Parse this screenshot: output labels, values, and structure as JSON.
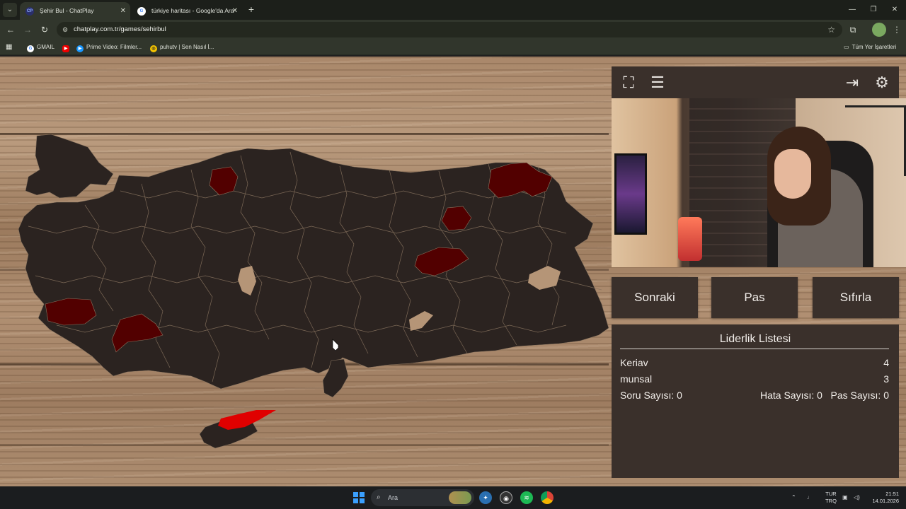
{
  "browser": {
    "tabs": [
      {
        "title": "Şehir Bul - ChatPlay",
        "favicon": "CP",
        "active": true
      },
      {
        "title": "türkiye haritası - Google'da Ara",
        "favicon": "G",
        "active": false
      }
    ],
    "url": "chatplay.com.tr/games/sehirbul",
    "bookmarks": [
      {
        "label": "GMAIL",
        "icon": "google-icon"
      },
      {
        "label": "",
        "icon": "youtube-icon"
      },
      {
        "label": "Prime Video: Filmler...",
        "icon": "prime-video-icon"
      },
      {
        "label": "puhutv | Sen Nasıl İ...",
        "icon": "puhutv-icon"
      }
    ],
    "all_bookmarks_label": "Tüm Yer İşaretleri"
  },
  "game": {
    "buttons": {
      "next": "Sonraki",
      "pass": "Pas",
      "reset": "Sıfırla"
    },
    "leaderboard": {
      "title": "Liderlik Listesi",
      "entries": [
        {
          "name": "Keriav",
          "score": "4"
        },
        {
          "name": "munsal",
          "score": "3"
        }
      ],
      "stats": {
        "questions": "Soru Sayısı: 0",
        "errors": "Hata Sayısı: 0",
        "passes": "Pas Sayısı: 0"
      }
    },
    "colors": {
      "map": "#2b2320",
      "guessed": "#520000",
      "highlight": "#e00000",
      "panel": "#3a302b"
    }
  },
  "taskbar": {
    "search_placeholder": "Ara",
    "language": {
      "line1": "TUR",
      "line2": "TRQ"
    },
    "time": "21:51",
    "date": "14.01.2026"
  }
}
